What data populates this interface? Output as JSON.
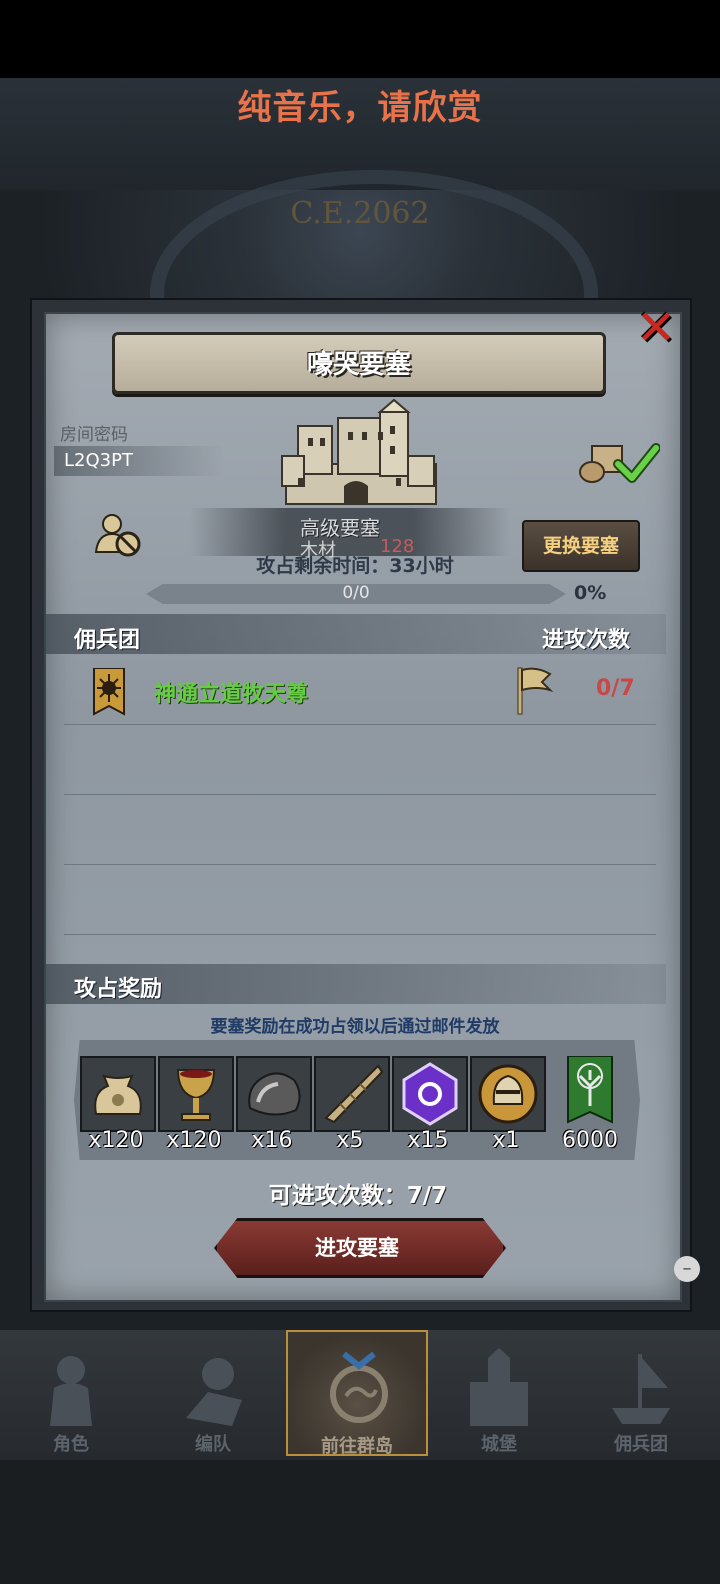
{
  "header": {
    "title": "纯音乐，请欣赏"
  },
  "background": {
    "era": "C.E.2062"
  },
  "dialog": {
    "title": "嚎哭要塞",
    "room_password_label": "房间密码",
    "room_password": "L2Q3PT",
    "fortress_level": "高级要塞",
    "resource_label": "木材",
    "resource_value": "128",
    "change_button": "更换要塞",
    "time_label": "攻占剩余时间：33小时",
    "progress_text": "0/0",
    "progress_percent": "0%",
    "progress_fraction": 0
  },
  "mercenary": {
    "section_label": "佣兵团",
    "attacks_label": "进攻次数",
    "guild_name": "神通立道牧天尊",
    "attack_count": "0/7"
  },
  "rewards": {
    "section_label": "攻占奖励",
    "note": "要塞奖励在成功占领以后通过邮件发放",
    "items": [
      {
        "icon": "grain-sack-icon",
        "qty": "x120"
      },
      {
        "icon": "goblet-icon",
        "qty": "x120"
      },
      {
        "icon": "ore-rock-icon",
        "qty": "x16"
      },
      {
        "icon": "horn-icon",
        "qty": "x5"
      },
      {
        "icon": "purple-crystal-icon",
        "qty": "x15"
      },
      {
        "icon": "knight-helmet-icon",
        "qty": "x1"
      },
      {
        "icon": "green-tree-banner-icon",
        "qty": "6000"
      }
    ]
  },
  "remaining_attacks": "可进攻次数：7/7",
  "attack_button": "进攻要塞",
  "bottom_nav": [
    {
      "label": "角色",
      "icon": "knight-icon"
    },
    {
      "label": "编队",
      "icon": "formation-icon"
    },
    {
      "label": "前往群岛",
      "icon": "islands-icon",
      "active": true
    },
    {
      "label": "城堡",
      "icon": "castle-icon"
    },
    {
      "label": "佣兵团",
      "icon": "ship-icon"
    }
  ],
  "colors": {
    "header_title": "#e8734a",
    "guild_name": "#66cc44",
    "attack_count": "#c84848",
    "button_accent": "#f4d080",
    "note": "#1f3b66"
  }
}
